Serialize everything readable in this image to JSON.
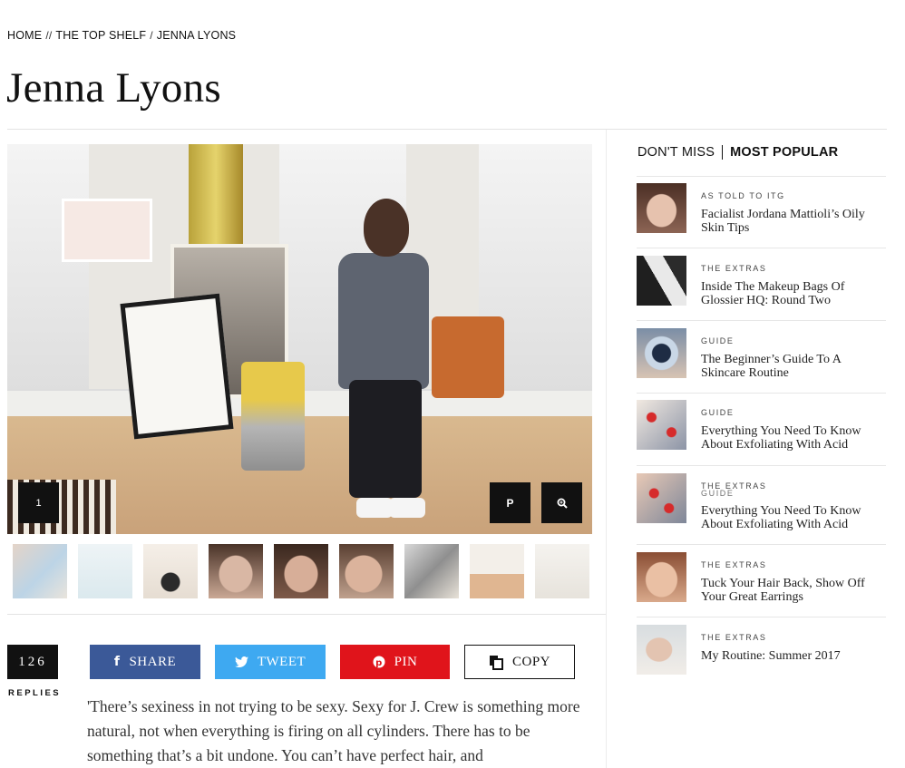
{
  "breadcrumb": {
    "home": "HOME",
    "sep1": "//",
    "section": "THE TOP SHELF",
    "sep2": "/",
    "current": "JENNA LYONS"
  },
  "page_title": "Jenna Lyons",
  "gallery": {
    "slide_number": "1",
    "pin_icon_label": "P",
    "zoom_icon": "zoom-icon",
    "thumbnail_count": 9
  },
  "engagement": {
    "replies_count": "126",
    "replies_label": "REPLIES"
  },
  "share": {
    "share_label": "SHARE",
    "tweet_label": "TWEET",
    "pin_label": "PIN",
    "copy_label": "COPY",
    "colors": {
      "facebook": "#3b5998",
      "twitter": "#3ea9f1",
      "pinterest": "#e0141b"
    }
  },
  "quote": "'There’s sexiness in not trying to be sexy. Sexy for J. Crew is something more natural, not when everything is firing on all cylinders. There has to be something that’s a bit undone. You can’t have perfect hair, and",
  "sidebar": {
    "tabs": [
      "DON'T MISS",
      "MOST POPULAR"
    ],
    "active_tab": "MOST POPULAR",
    "items": [
      {
        "category": "AS TOLD TO ITG",
        "headline": "Facialist Jordana Mattioli’s Oily Skin Tips"
      },
      {
        "category": "THE EXTRAS",
        "headline": "Inside The Makeup Bags Of Glossier HQ: Round Two"
      },
      {
        "category": "GUIDE",
        "headline": "The Beginner’s Guide To A Skincare Routine"
      },
      {
        "category": "GUIDE",
        "headline": "Everything You Need To Know About Exfoliating With Acid"
      },
      {
        "category": "THE EXTRAS",
        "overlap_category": "GUIDE",
        "headline": "Everything You Need To Know About Exfoliating With Acid"
      },
      {
        "category": "THE EXTRAS",
        "headline": "Tuck Your Hair Back, Show Off Your Great Earrings"
      },
      {
        "category": "THE EXTRAS",
        "headline": "My Routine: Summer 2017"
      }
    ]
  }
}
